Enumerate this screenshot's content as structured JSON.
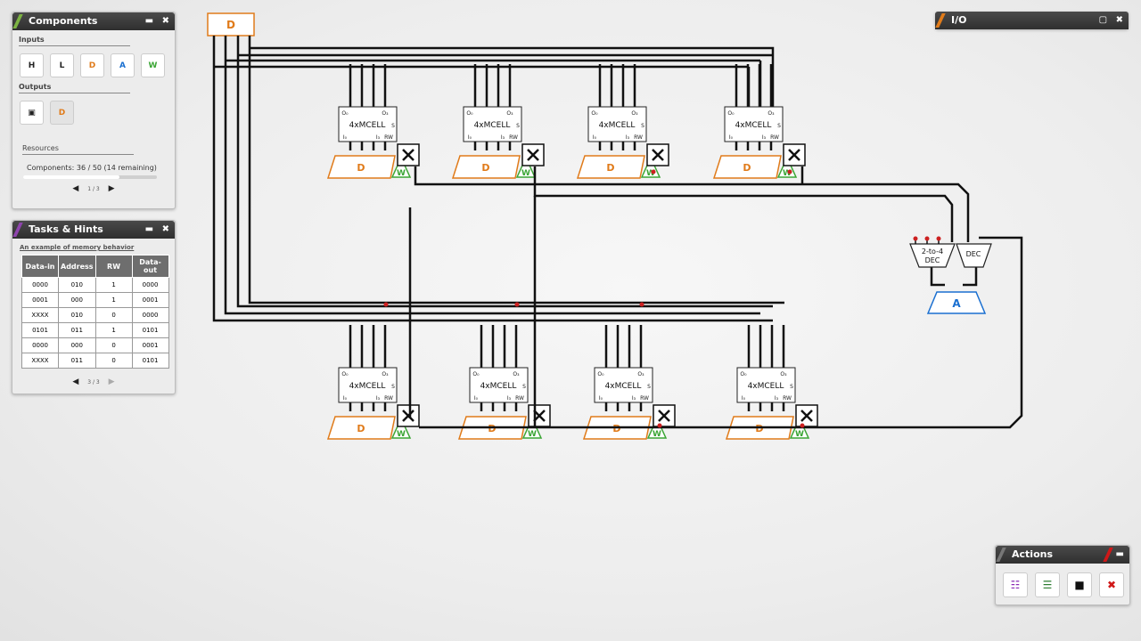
{
  "components_panel": {
    "title": "Components",
    "inputs_label": "Inputs",
    "outputs_label": "Outputs",
    "resources_label": "Resources",
    "components_status": "Components: 36 / 50 (14 remaining)",
    "components_used_fraction": 0.72,
    "page_indicator": "1 / 3",
    "input_items": [
      {
        "name": "high-input",
        "glyph": "H",
        "color": "#222222"
      },
      {
        "name": "low-input",
        "glyph": "L",
        "color": "#222222"
      },
      {
        "name": "data-input",
        "glyph": "D",
        "color": "#e07b1a"
      },
      {
        "name": "address-input",
        "glyph": "A",
        "color": "#1a6fd0"
      },
      {
        "name": "write-input",
        "glyph": "W",
        "color": "#3aa534"
      }
    ],
    "output_items": [
      {
        "name": "probe-output",
        "glyph": "▣",
        "color": "#222222"
      },
      {
        "name": "data-output",
        "glyph": "D",
        "color": "#e07b1a"
      }
    ]
  },
  "tasks_panel": {
    "title": "Tasks & Hints",
    "task_title": "An example of memory behavior",
    "columns": [
      "Data-in",
      "Address",
      "RW",
      "Data-out"
    ],
    "rows": [
      [
        "0000",
        "010",
        "1",
        "0000"
      ],
      [
        "0001",
        "000",
        "1",
        "0001"
      ],
      [
        "XXXX",
        "010",
        "0",
        "0000"
      ],
      [
        "0101",
        "011",
        "1",
        "0101"
      ],
      [
        "0000",
        "000",
        "0",
        "0001"
      ],
      [
        "XXXX",
        "011",
        "0",
        "0101"
      ]
    ],
    "page_indicator": "3 / 3"
  },
  "io_panel": {
    "title": "I/O"
  },
  "actions_panel": {
    "title": "Actions",
    "buttons": [
      {
        "name": "hint-button",
        "glyph": "☷",
        "color": "#8a2bb5"
      },
      {
        "name": "layout-button",
        "glyph": "☰",
        "color": "#2e7d32"
      },
      {
        "name": "save-button",
        "glyph": "■",
        "color": "#111111"
      },
      {
        "name": "reset-button",
        "glyph": "✖",
        "color": "#d01818"
      }
    ]
  },
  "circuit": {
    "cell_label": "4xMCELL",
    "cell_out_left": "O₀",
    "cell_out_right": "O₃",
    "cell_in_left": "I₀",
    "cell_in_right": "I₃",
    "cell_select": "S",
    "cell_rw": "RW",
    "data_label": "D",
    "write_label": "W",
    "decoder2_label": [
      "2-to-4",
      "DEC"
    ],
    "decoder_label": "DEC",
    "address_label": "A",
    "top_input_label": "D",
    "colors": {
      "data": "#e07b1a",
      "write": "#3aa534",
      "address": "#1a6fd0",
      "wire": "#111111",
      "pin": "#cc2020"
    }
  }
}
